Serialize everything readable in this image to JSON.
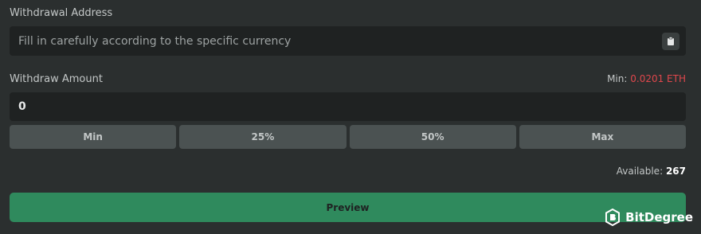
{
  "address": {
    "label": "Withdrawal Address",
    "placeholder": "Fill in carefully according to the specific currency",
    "paste_icon": "paste-icon"
  },
  "amount": {
    "label": "Withdraw Amount",
    "min_label": "Min:",
    "min_value": "0.0201 ETH",
    "value": "0"
  },
  "quick_amounts": [
    "Min",
    "25%",
    "50%",
    "Max"
  ],
  "available": {
    "label": "Available:",
    "value": "267"
  },
  "preview_label": "Preview",
  "watermark": "BitDegree",
  "colors": {
    "background": "#2b2f2f",
    "field": "#1f2222",
    "button": "#4b5252",
    "accent_green": "#2f8a5d",
    "min_red": "#e0474c"
  }
}
